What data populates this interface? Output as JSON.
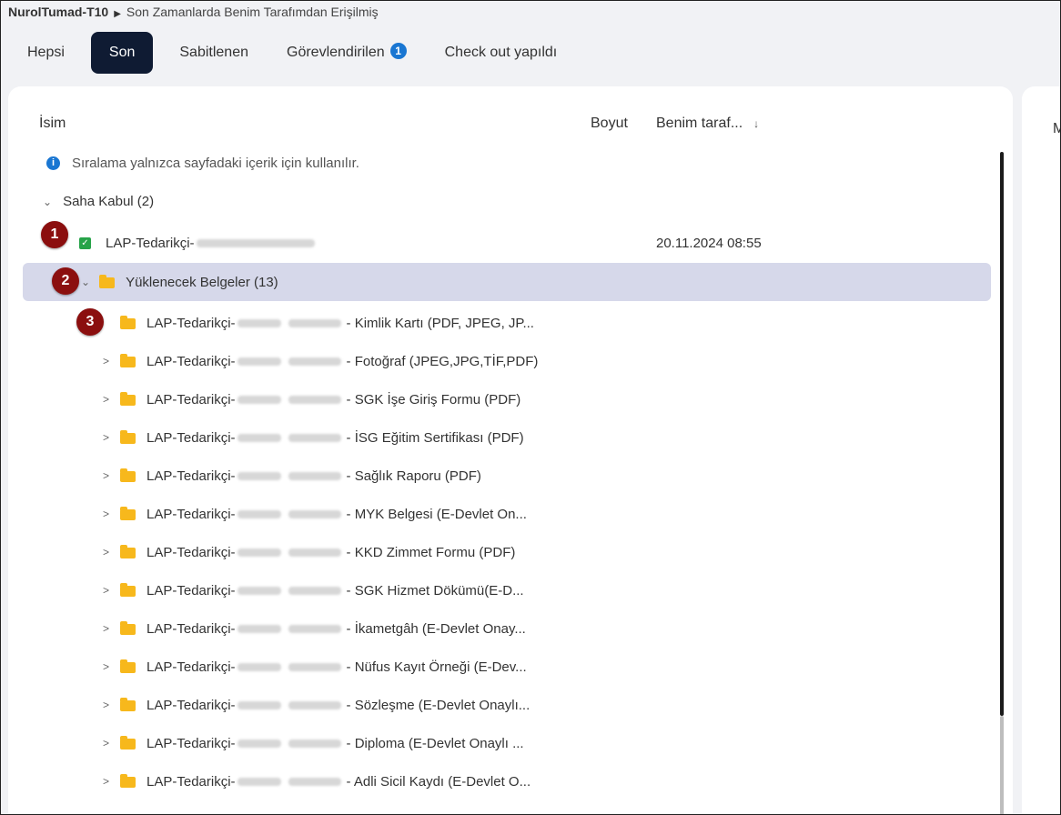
{
  "breadcrumb": {
    "root": "NurolTumad-T10",
    "current": "Son Zamanlarda Benim Tarafımdan Erişilmiş"
  },
  "tabs": [
    {
      "label": "Hepsi",
      "active": false
    },
    {
      "label": "Son",
      "active": true
    },
    {
      "label": "Sabitlenen",
      "active": false
    },
    {
      "label": "Görevlendirilen",
      "active": false,
      "badge": "1"
    },
    {
      "label": "Check out yapıldı",
      "active": false
    }
  ],
  "columns": {
    "name": "İsim",
    "size": "Boyut",
    "accessed": "Benim taraf..."
  },
  "info": "Sıralama yalnızca sayfadaki içerik için kullanılır.",
  "group": {
    "label": "Saha Kabul (2)"
  },
  "items": {
    "file": {
      "name": "LAP-Tedarikçi-",
      "date": "20.11.2024 08:55"
    },
    "folder": {
      "name": "Yüklenecek Belgeler (13)"
    }
  },
  "subfolders": [
    {
      "prefix": "LAP-Tedarikçi-",
      "suffix": "- Kimlik Kartı (PDF, JPEG, JP..."
    },
    {
      "prefix": "LAP-Tedarikçi-",
      "suffix": "- Fotoğraf (JPEG,JPG,TİF,PDF)"
    },
    {
      "prefix": "LAP-Tedarikçi-",
      "suffix": "- SGK İşe Giriş Formu (PDF)"
    },
    {
      "prefix": "LAP-Tedarikçi-",
      "suffix": "- İSG Eğitim Sertifikası (PDF)"
    },
    {
      "prefix": "LAP-Tedarikçi-",
      "suffix": "- Sağlık Raporu (PDF)"
    },
    {
      "prefix": "LAP-Tedarikçi-",
      "suffix": "- MYK Belgesi (E-Devlet On..."
    },
    {
      "prefix": "LAP-Tedarikçi-",
      "suffix": "- KKD Zimmet Formu (PDF)"
    },
    {
      "prefix": "LAP-Tedarikçi-",
      "suffix": "- SGK Hizmet Dökümü(E-D..."
    },
    {
      "prefix": "LAP-Tedarikçi-",
      "suffix": "- İkametgâh (E-Devlet Onay..."
    },
    {
      "prefix": "LAP-Tedarikçi-",
      "suffix": "- Nüfus Kayıt Örneği (E-Dev..."
    },
    {
      "prefix": "LAP-Tedarikçi-",
      "suffix": "- Sözleşme (E-Devlet Onaylı..."
    },
    {
      "prefix": "LAP-Tedarikçi-",
      "suffix": "- Diploma (E-Devlet Onaylı ..."
    },
    {
      "prefix": "LAP-Tedarikçi-",
      "suffix": "- Adli Sicil Kaydı (E-Devlet O..."
    }
  ],
  "markers": [
    "1",
    "2",
    "3"
  ],
  "right_panel": {
    "label": "M"
  },
  "colors": {
    "active_tab": "#0f1b33",
    "badge": "#1976d2",
    "folder": "#f7b81c",
    "check": "#27a349",
    "selected_row": "#d6d8ea",
    "marker": "#8b0f0f"
  }
}
